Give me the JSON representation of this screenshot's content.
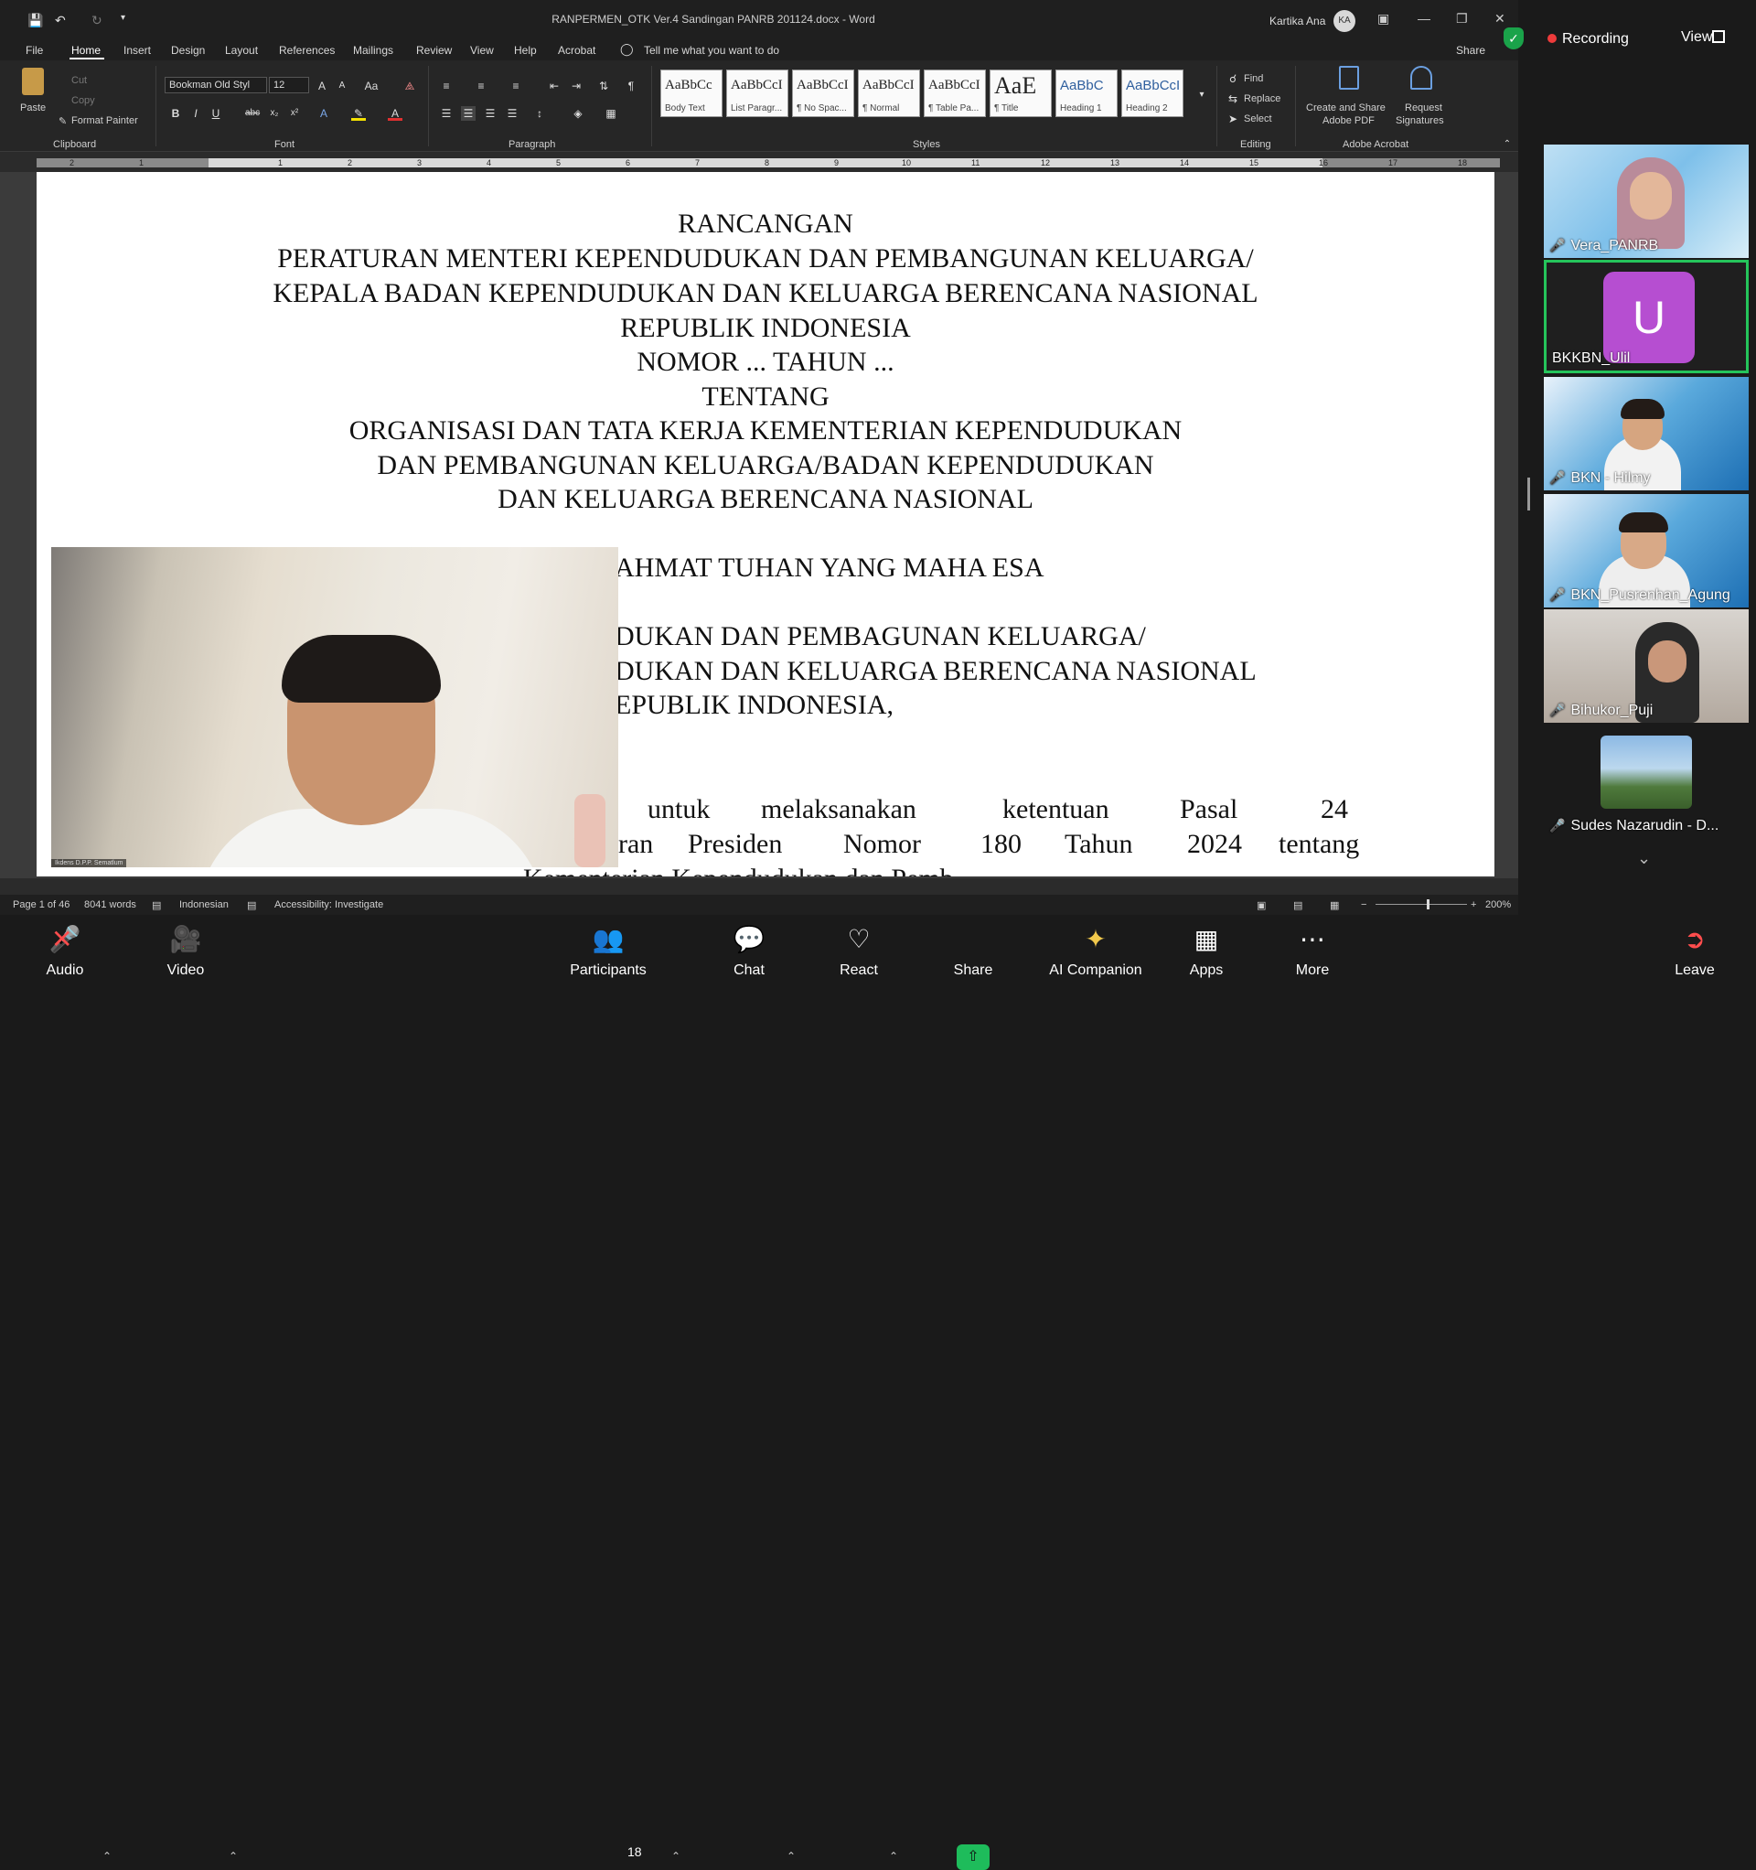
{
  "word": {
    "title": "RANPERMEN_OTK Ver.4 Sandingan PANRB 201124.docx  -  Word",
    "user_name": "Kartika Ana",
    "user_initials": "KA",
    "menu": [
      "File",
      "Home",
      "Insert",
      "Design",
      "Layout",
      "References",
      "Mailings",
      "Review",
      "View",
      "Help",
      "Acrobat"
    ],
    "tell_me": "Tell me what you want to do",
    "share": "Share",
    "ribbon": {
      "paste": "Paste",
      "cut": "Cut",
      "copy": "Copy",
      "format_painter": "Format Painter",
      "clipboard": "Clipboard",
      "font_name": "Bookman Old Styl",
      "font_size": "12",
      "font": "Font",
      "paragraph": "Paragraph",
      "styles": "Styles",
      "find": "Find",
      "replace": "Replace",
      "select": "Select",
      "editing": "Editing",
      "create_share_pdf_1": "Create and Share",
      "create_share_pdf_2": "Adobe PDF",
      "request_sig_1": "Request",
      "request_sig_2": "Signatures",
      "adobe_acrobat": "Adobe Acrobat",
      "style_tiles": [
        {
          "sample": "AaBbCc",
          "name": "Body Text"
        },
        {
          "sample": "AaBbCcI",
          "name": "List Paragr..."
        },
        {
          "sample": "AaBbCcI",
          "name": "¶ No Spac..."
        },
        {
          "sample": "AaBbCcI",
          "name": "¶ Normal"
        },
        {
          "sample": "AaBbCcI",
          "name": "¶ Table Pa..."
        },
        {
          "sample": "AaE",
          "name": "¶ Title"
        },
        {
          "sample": "AaBbC",
          "name": "Heading 1"
        },
        {
          "sample": "AaBbCcI",
          "name": "Heading 2"
        }
      ]
    },
    "ruler_numbers": [
      "2",
      "1",
      "1",
      "2",
      "3",
      "4",
      "5",
      "6",
      "7",
      "8",
      "9",
      "10",
      "11",
      "12",
      "13",
      "14",
      "15",
      "16",
      "17",
      "18"
    ],
    "document_lines": [
      "RANCANGAN",
      "PERATURAN MENTERI KEPENDUDUKAN DAN PEMBANGUNAN KELUARGA/",
      "KEPALA BADAN KEPENDUDUKAN DAN KELUARGA BERENCANA NASIONAL",
      "REPUBLIK INDONESIA",
      "NOMOR ... TAHUN ...",
      "TENTANG",
      "ORGANISASI DAN TATA KERJA KEMENTERIAN KEPENDUDUKAN",
      "DAN PEMBANGUNAN KELUARGA/BADAN KEPENDUDUKAN",
      "DAN KELUARGA BERENCANA NASIONAL"
    ],
    "document_partial_lines": [
      "AHMAT TUHAN YANG MAHA ESA",
      "DUKAN DAN PEMBAGUNAN KELUARGA/",
      "DUKAN DAN KELUARGA BERENCANA NASIONAL",
      "EPUBLIK INDONESIA,"
    ],
    "body_line_1": [
      "untuk",
      "melaksanakan",
      "ketentuan",
      "Pasal",
      "24"
    ],
    "body_line_2": [
      "ran",
      "Presiden",
      "Nomor",
      "180",
      "Tahun",
      "2024",
      "tentang"
    ],
    "body_line_3_partial": "Kementerian   Kependudukan   dan   Pemb",
    "status": {
      "page": "Page 1 of 46",
      "words": "8041 words",
      "language": "Indonesian",
      "accessibility": "Accessibility: Investigate",
      "zoom": "200%"
    }
  },
  "speaker_video": {
    "caption": "Ikdens D.P.P. Sematlum"
  },
  "zoom": {
    "recording": "Recording",
    "view": "View",
    "participants": [
      {
        "name": "Vera_PANRB",
        "muted": true
      },
      {
        "name": "BKKBN_Ulil",
        "muted": false,
        "avatar": "U"
      },
      {
        "name": "BKN - Hilmy",
        "muted": true
      },
      {
        "name": "BKN_Pusrenhan_Agung",
        "muted": true
      },
      {
        "name": "Bihukor_Puji",
        "muted": true
      },
      {
        "name": "Sudes Nazarudin  - D...",
        "muted": true
      }
    ],
    "toolbar": {
      "audio": "Audio",
      "video": "Video",
      "participants": "Participants",
      "participant_count": "18",
      "chat": "Chat",
      "react": "React",
      "share": "Share",
      "ai_companion": "AI Companion",
      "apps": "Apps",
      "more": "More",
      "leave": "Leave"
    },
    "colors": {
      "active_speaker_border": "#25c45b",
      "share_green": "#1ebc5b",
      "muted_red": "#ff4d4d",
      "avatar_purple": "#b64ed1"
    }
  }
}
